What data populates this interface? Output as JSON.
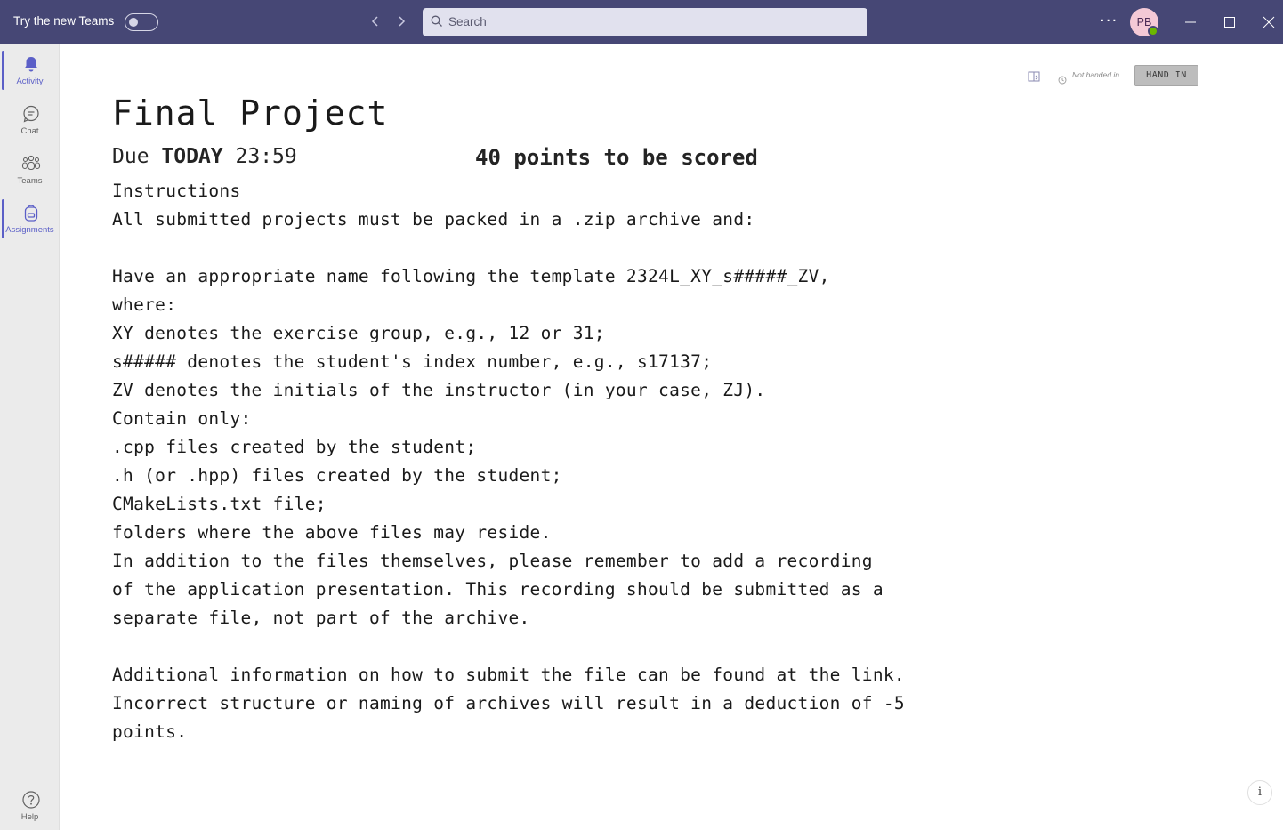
{
  "titlebar": {
    "try_new_label": "Try the new Teams",
    "search_placeholder": "Search",
    "more_label": "···",
    "avatar_initials": "PB",
    "accent": "#464775"
  },
  "rail": {
    "items": [
      {
        "label": "Activity",
        "icon": "bell-icon"
      },
      {
        "label": "Chat",
        "icon": "chat-icon"
      },
      {
        "label": "Teams",
        "icon": "teams-icon"
      },
      {
        "label": "Assignments",
        "icon": "backpack-icon"
      }
    ],
    "help_label": "Help",
    "active_color": "#5b5fc7"
  },
  "assignment": {
    "status": "Not handed in",
    "hand_in_label": "HAND IN",
    "title": "Final Project",
    "due_prefix": "Due",
    "due_day": "TODAY",
    "due_time": "23:59",
    "points": "40 points to be scored",
    "lines": [
      "Instructions",
      "All submitted projects must be packed in a .zip archive and:",
      "",
      "Have an appropriate name following the template 2324L_XY_s#####_ZV,",
      "where:",
      "XY denotes the exercise group, e.g., 12 or 31;",
      "s##### denotes the student's index number, e.g., s17137;",
      "ZV denotes the initials of the instructor (in your case, ZJ).",
      "Contain only:",
      ".cpp files created by the student;",
      ".h (or .hpp) files created by the student;",
      "CMakeLists.txt file;",
      "folders where the above files may reside.",
      "In addition to the files themselves, please remember to add a recording",
      "of the application presentation. This recording should be submitted as a",
      "separate file, not part of the archive.",
      "",
      "Additional information on how to submit the file can be found at the link.",
      "Incorrect structure or naming of archives will result in a deduction of -5",
      "points."
    ]
  }
}
